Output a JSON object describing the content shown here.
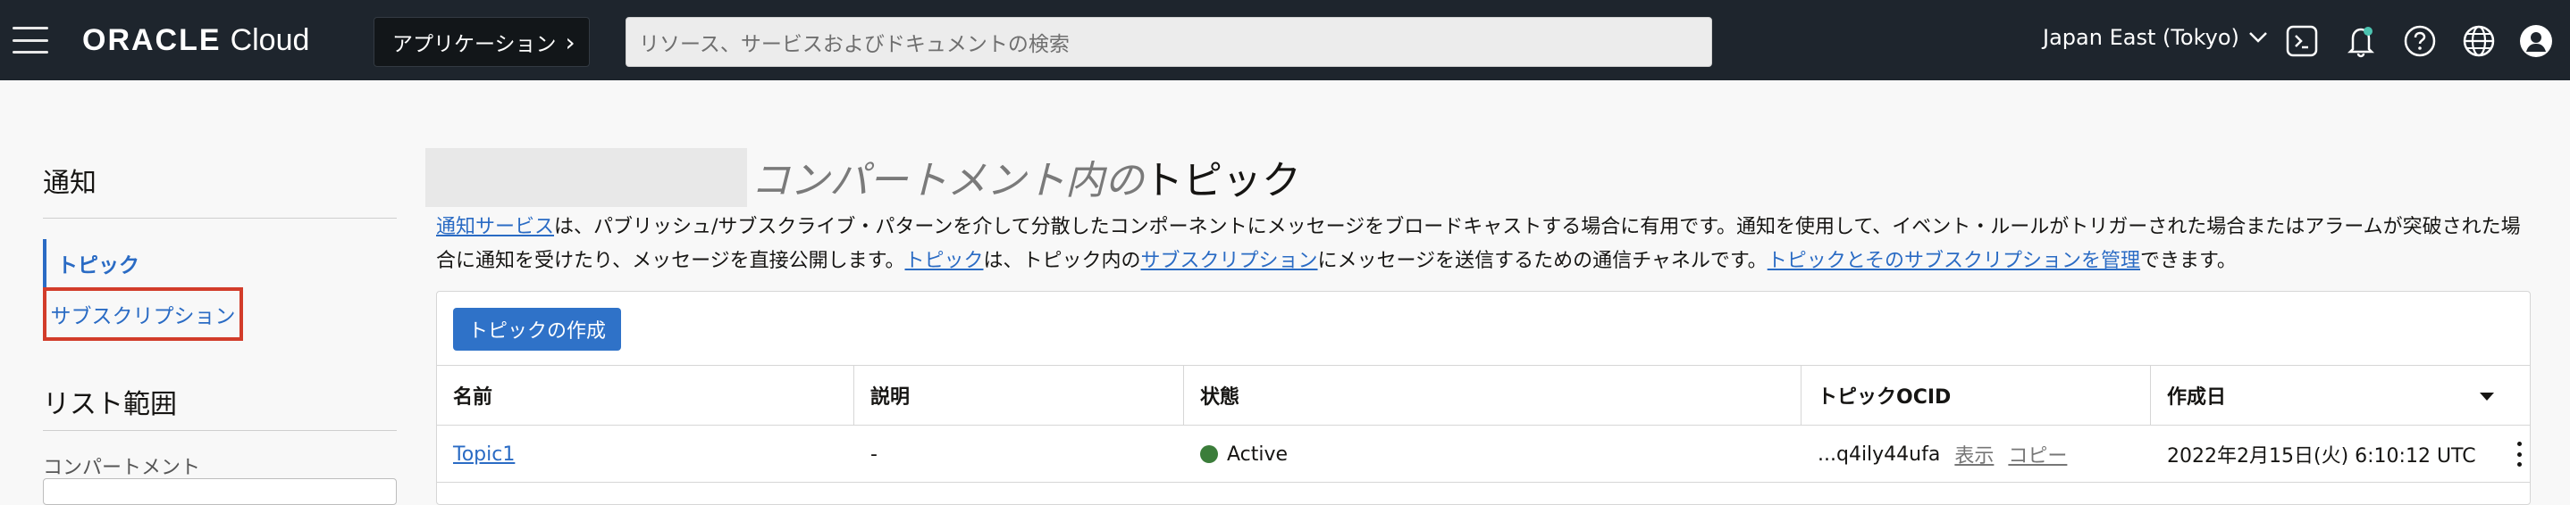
{
  "header": {
    "brand": "ORACLE",
    "brand_sub": "Cloud",
    "apps_label": "アプリケーション",
    "search_placeholder": "リソース、サービスおよびドキュメントの検索",
    "region": "Japan East (Tokyo)",
    "icons": [
      "cloud-shell-icon",
      "notifications-bell-icon",
      "help-icon",
      "language-globe-icon",
      "user-profile-icon"
    ]
  },
  "sidebar": {
    "title": "通知",
    "items": [
      {
        "label": "トピック",
        "active": true
      },
      {
        "label": "サブスクリプション",
        "active": false
      }
    ],
    "scope_title": "リスト範囲",
    "compartment_label": "コンパートメント"
  },
  "main": {
    "title_prefix": "コンパートメント内の",
    "title": "トピック",
    "desc": {
      "link1": "通知サービス",
      "text1": "は、パブリッシュ/サブスクライブ・パターンを介して分散したコンポーネントにメッセージをブロードキャストする場合に有用です。通知を使用して、イベント・ルールがトリガーされた場合またはアラームが突破された場合に通知を受けたり、メッセージを直接公開します。",
      "link2": "トピック",
      "text2": "は、トピック内の",
      "link3": "サブスクリプション",
      "text3": "にメッセージを送信するための通信チャネルです。",
      "link4": "トピックとそのサブスクリプションを管理",
      "text4": "できます。"
    },
    "create_button": "トピックの作成",
    "table": {
      "columns": [
        "名前",
        "説明",
        "状態",
        "トピックOCID",
        "作成日"
      ],
      "rows": [
        {
          "name": "Topic1",
          "description": "-",
          "state": "Active",
          "ocid": "...q4ily44ufa",
          "show": "表示",
          "copy": "コピー",
          "created": "2022年2月15日(火) 6:10:12 UTC"
        }
      ]
    }
  },
  "colors": {
    "topbar": "#1e252d",
    "link": "#2a6bc4",
    "primary_button": "#2f72c8",
    "highlight_box": "#d23c2a",
    "status_active": "#3b7d3a"
  }
}
